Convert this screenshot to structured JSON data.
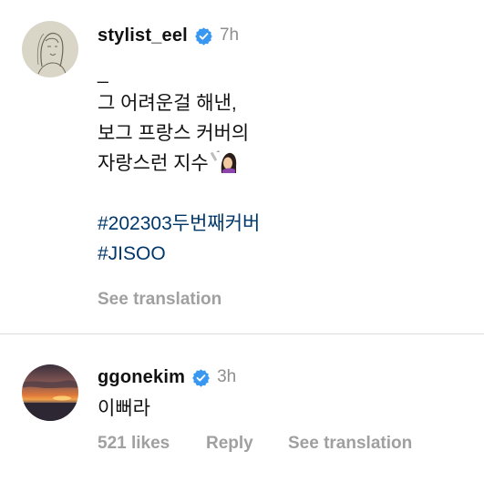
{
  "post": {
    "username": "stylist_eel",
    "time": "7h",
    "lines": [
      "_",
      "그 어려운걸 해낸,",
      "보그 프랑스 커버의",
      "자랑스런 지수",
      "",
      "#202303두번째커버",
      "#JISOO"
    ],
    "see_translation": "See translation",
    "emoji_icon": "woman-getting-haircut-emoji"
  },
  "reply": {
    "username": "ggonekim",
    "time": "3h",
    "text": "이뻐라",
    "likes": "521 likes",
    "reply_label": "Reply",
    "see_translation": "See translation"
  },
  "colors": {
    "verified": "#3897f0",
    "hashtag": "#00376b",
    "muted": "#8e8e8e",
    "action": "#a0a0a0"
  }
}
